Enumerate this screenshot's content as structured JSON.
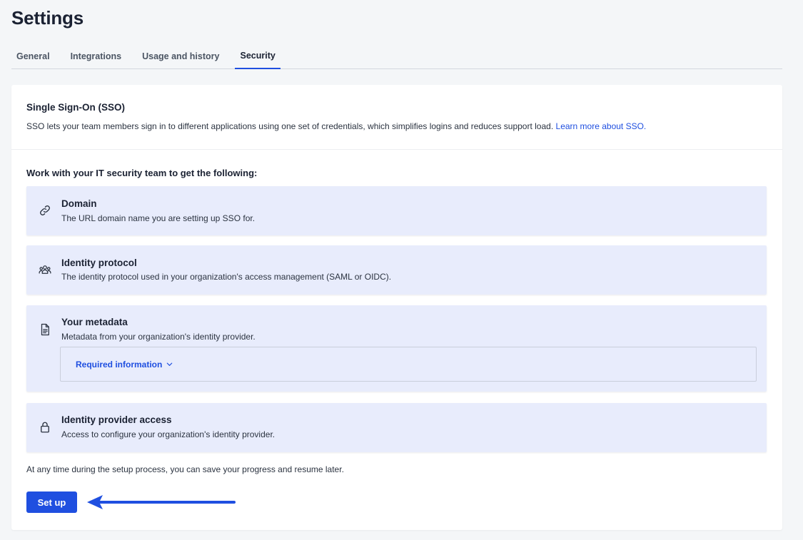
{
  "page": {
    "title": "Settings"
  },
  "tabs": [
    {
      "label": "General",
      "active": false
    },
    {
      "label": "Integrations",
      "active": false
    },
    {
      "label": "Usage and history",
      "active": false
    },
    {
      "label": "Security",
      "active": true
    }
  ],
  "sso": {
    "title": "Single Sign-On (SSO)",
    "description": "SSO lets your team members sign in to different applications using one set of credentials, which simplifies logins and reduces support load.",
    "link_label": "Learn more about SSO."
  },
  "requirements": {
    "heading": "Work with your IT security team to get the following:",
    "items": [
      {
        "icon": "link-icon",
        "title": "Domain",
        "description": "The URL domain name you are setting up SSO for."
      },
      {
        "icon": "users-icon",
        "title": "Identity protocol",
        "description": "The identity protocol used in your organization's access management (SAML or OIDC)."
      },
      {
        "icon": "document-icon",
        "title": "Your metadata",
        "description": "Metadata from your organization's identity provider.",
        "expand_label": "Required information"
      },
      {
        "icon": "lock-icon",
        "title": "Identity provider access",
        "description": "Access to configure your organization's identity provider."
      }
    ]
  },
  "footer": {
    "note": "At any time during the setup process, you can save your progress and resume later.",
    "setup_label": "Set up"
  },
  "colors": {
    "accent": "#1f4fe0",
    "item_background": "#e8ecfc",
    "page_background": "#f4f6f8"
  }
}
